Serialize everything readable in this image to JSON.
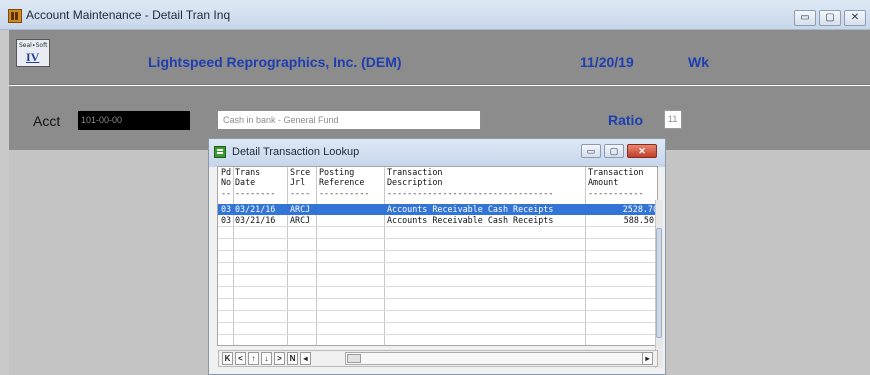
{
  "window": {
    "title": "Account Maintenance - Detail Tran Inq",
    "controls": [
      "▭",
      "▢",
      "✕"
    ]
  },
  "header": {
    "logo_text": "IV",
    "logo_small": "Seal∙Soft",
    "company": "Lightspeed Reprographics, Inc. (DEM)",
    "date": "11/20/19",
    "week": "Wk"
  },
  "form": {
    "acct_label": "Acct",
    "acct_value": "101-00-00",
    "description": "Cash in bank - General Fund",
    "ratio_label": "Ratio",
    "ratio_value": "11"
  },
  "dialog": {
    "title": "Detail Transaction Lookup",
    "controls": [
      "▭",
      "▢",
      "✕"
    ],
    "columns": [
      {
        "line1": "Pd",
        "line2": "No"
      },
      {
        "line1": "Trans",
        "line2": "Date"
      },
      {
        "line1": "Srce",
        "line2": "Jrl"
      },
      {
        "line1": "Posting",
        "line2": "Reference"
      },
      {
        "line1": "Transaction",
        "line2": "Description"
      },
      {
        "line1": "Transaction",
        "line2": "Amount"
      }
    ],
    "rows": [
      {
        "pd": "03",
        "date": "03/21/16",
        "srce": "ARCJ",
        "ref": "",
        "desc": "Accounts Receivable Cash Receipts",
        "amount": "2528.70",
        "selected": true
      },
      {
        "pd": "03",
        "date": "03/21/16",
        "srce": "ARCJ",
        "ref": "",
        "desc": "Accounts Receivable Cash Receipts",
        "amount": "588.50",
        "selected": false
      }
    ],
    "nav_buttons": [
      "K",
      "<",
      "↑",
      "↓",
      ">",
      "N",
      "◂"
    ],
    "scroll_right": "▸"
  }
}
